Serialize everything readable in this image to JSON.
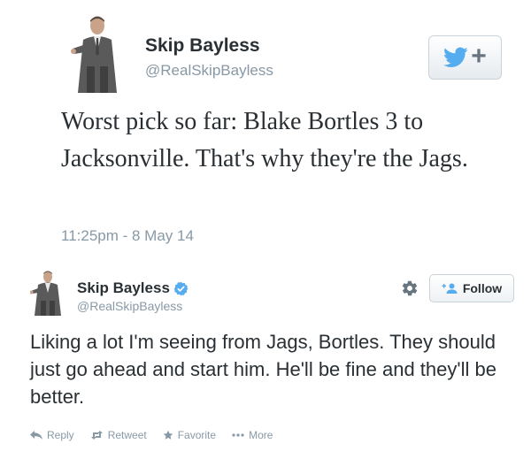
{
  "tweet1": {
    "author_name": "Skip Bayless",
    "author_handle": "@RealSkipBayless",
    "follow_icon": "twitter-bird-plus-icon",
    "text": "Worst pick so far: Blake Bortles 3 to Jacksonville. That's why they're the Jags.",
    "timestamp": "11:25pm - 8 May 14",
    "colors": {
      "bird": "#55acee",
      "muted": "#8899a6",
      "text": "#292f33"
    }
  },
  "tweet2": {
    "author_name": "Skip Bayless",
    "verified_icon": "verified-badge-icon",
    "author_handle": "@RealSkipBayless",
    "gear_icon": "gear-icon",
    "follow_label": "Follow",
    "follow_icon": "add-user-icon",
    "text": "Liking a lot I'm seeing from Jags, Bortles. They should just go ahead and start him. He'll be fine and they'll be better.",
    "actions": [
      {
        "icon": "reply-icon",
        "label": "Reply"
      },
      {
        "icon": "retweet-icon",
        "label": "Retweet"
      },
      {
        "icon": "star-icon",
        "label": "Favorite"
      },
      {
        "icon": "more-dots-icon",
        "label": "More"
      }
    ],
    "colors": {
      "verified": "#55acee",
      "muted": "#8899a6"
    }
  }
}
